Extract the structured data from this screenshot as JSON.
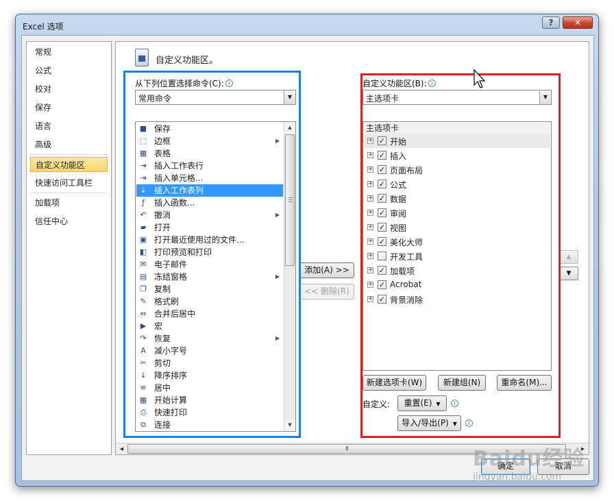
{
  "window": {
    "title": "Excel 选项",
    "help": "?",
    "close": "✕"
  },
  "nav": {
    "items": [
      "常规",
      "公式",
      "校对",
      "保存",
      "语言",
      "高级",
      "自定义功能区",
      "快速访问工具栏",
      "加载项",
      "信任中心"
    ],
    "selected": "自定义功能区"
  },
  "header": {
    "title": "自定义功能区。"
  },
  "left_panel": {
    "label": "从下列位置选择命令(C):",
    "dropdown_value": "常用命令",
    "commands": [
      {
        "label": "保存",
        "icon": "save-icon"
      },
      {
        "label": "边框",
        "icon": "border-icon",
        "submenu": true
      },
      {
        "label": "表格",
        "icon": "table-icon"
      },
      {
        "label": "插入工作表行",
        "icon": "insert-row-icon"
      },
      {
        "label": "插入单元格...",
        "icon": "insert-cells-icon"
      },
      {
        "label": "插入工作表列",
        "icon": "insert-column-icon",
        "selected": true
      },
      {
        "label": "插入函数...",
        "icon": "function-icon"
      },
      {
        "label": "撤消",
        "icon": "undo-icon",
        "submenu": true
      },
      {
        "label": "打开",
        "icon": "open-folder-icon"
      },
      {
        "label": "打开最近使用过的文件...",
        "icon": "recent-file-icon"
      },
      {
        "label": "打印预览和打印",
        "icon": "print-preview-icon"
      },
      {
        "label": "电子邮件",
        "icon": "email-icon"
      },
      {
        "label": "冻结窗格",
        "icon": "freeze-panes-icon",
        "submenu": true
      },
      {
        "label": "复制",
        "icon": "copy-icon"
      },
      {
        "label": "格式刷",
        "icon": "format-painter-icon"
      },
      {
        "label": "合并后居中",
        "icon": "merge-center-icon"
      },
      {
        "label": "宏",
        "icon": "macro-icon"
      },
      {
        "label": "恢复",
        "icon": "redo-icon",
        "submenu": true
      },
      {
        "label": "减小字号",
        "icon": "decrease-font-icon"
      },
      {
        "label": "剪切",
        "icon": "cut-icon"
      },
      {
        "label": "降序排序",
        "icon": "sort-descending-icon"
      },
      {
        "label": "居中",
        "icon": "center-align-icon"
      },
      {
        "label": "开始计算",
        "icon": "calculate-icon"
      },
      {
        "label": "快速打印",
        "icon": "quick-print-icon"
      },
      {
        "label": "连接",
        "icon": "connections-icon"
      }
    ]
  },
  "middle": {
    "add_button": "添加(A) >>",
    "remove_button": "<< 删除(R)"
  },
  "right_panel": {
    "label": "自定义功能区(B):",
    "dropdown_value": "主选项卡",
    "tree_header": "主选项卡",
    "tabs": [
      {
        "label": "开始",
        "checked": true
      },
      {
        "label": "插入",
        "checked": true
      },
      {
        "label": "页面布局",
        "checked": true
      },
      {
        "label": "公式",
        "checked": true
      },
      {
        "label": "数据",
        "checked": true
      },
      {
        "label": "审阅",
        "checked": true
      },
      {
        "label": "视图",
        "checked": true
      },
      {
        "label": "美化大师",
        "checked": true
      },
      {
        "label": "开发工具",
        "checked": false
      },
      {
        "label": "加载项",
        "checked": true
      },
      {
        "label": "Acrobat",
        "checked": true
      },
      {
        "label": "背景消除",
        "checked": true
      }
    ],
    "new_tab_button": "新建选项卡(W)",
    "new_group_button": "新建组(N)",
    "rename_button": "重命名(M)...",
    "customize_label": "自定义:",
    "reset_button": "重置(E)",
    "import_export_button": "导入/导出(P)"
  },
  "footer": {
    "ok_button": "确定",
    "cancel_button": "取消"
  },
  "watermark": {
    "brand": "Baidu经验",
    "url": "jingyan.baidu.com"
  },
  "colors": {
    "highlight_left": "#1f7fe0",
    "highlight_right": "#e01e1e",
    "selection": "#3399ff",
    "nav_selected": "#f9d56a"
  }
}
